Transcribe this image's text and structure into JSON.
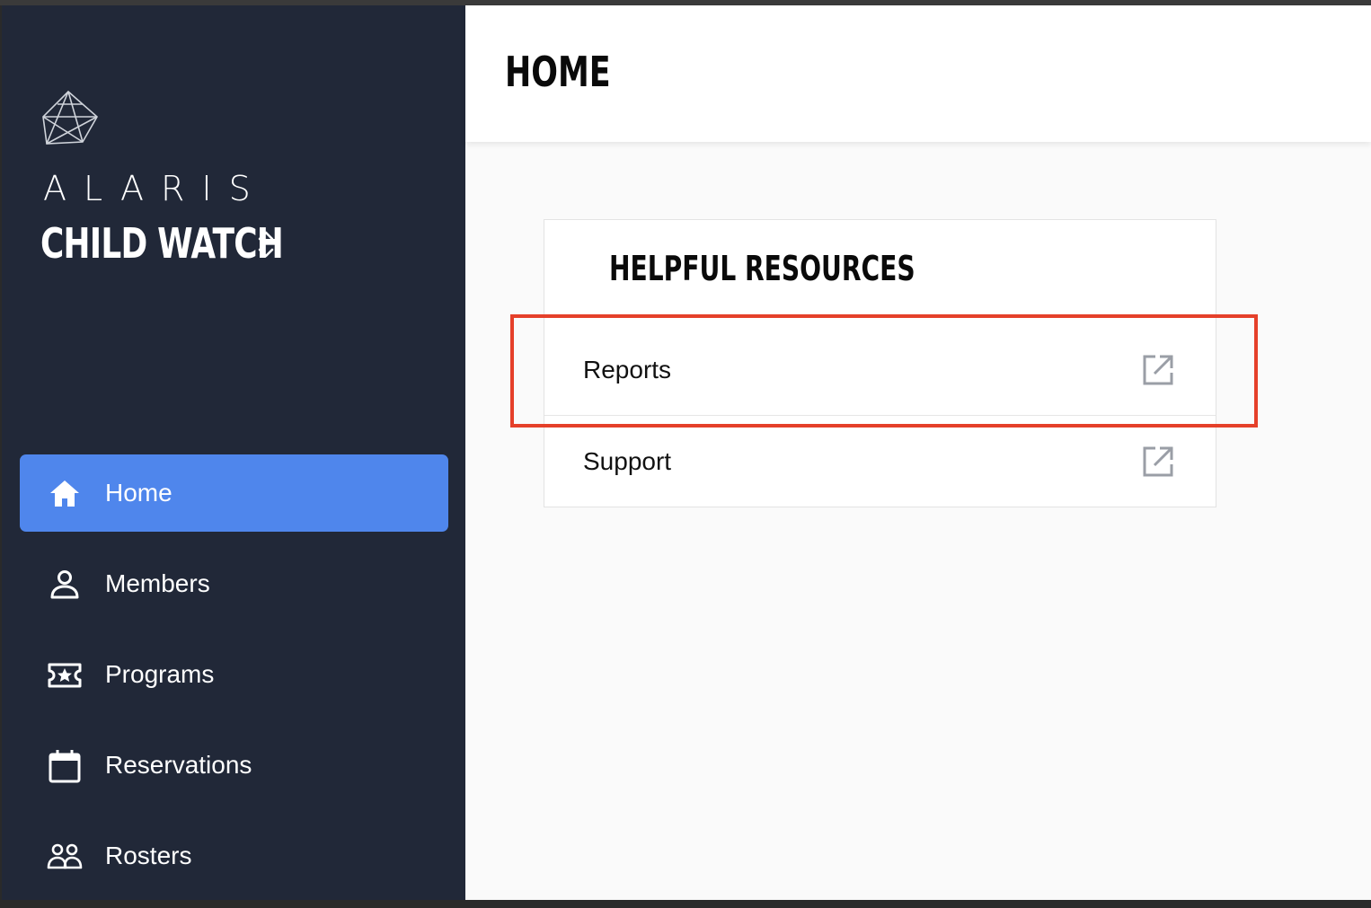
{
  "sidebar": {
    "brand": "ALARIS",
    "app_title": "CHILD WATCH",
    "icons": {
      "logo": "alaris-geometric-logo-icon",
      "switcher": "chevron-up-down-icon"
    },
    "items": [
      {
        "label": "Home",
        "icon": "home-icon",
        "active": true
      },
      {
        "label": "Members",
        "icon": "user-icon",
        "active": false
      },
      {
        "label": "Programs",
        "icon": "ticket-star-icon",
        "active": false
      },
      {
        "label": "Reservations",
        "icon": "calendar-icon",
        "active": false
      },
      {
        "label": "Rosters",
        "icon": "users-icon",
        "active": false
      }
    ]
  },
  "header": {
    "title": "HOME"
  },
  "resources": {
    "title": "HELPFUL RESOURCES",
    "items": [
      {
        "label": "Reports",
        "icon": "external-link-icon",
        "highlighted": true
      },
      {
        "label": "Support",
        "icon": "external-link-icon",
        "highlighted": false
      }
    ]
  },
  "colors": {
    "sidebar_bg": "#212838",
    "active_item_bg": "#4f86ec",
    "highlight": "#e5402a",
    "main_bg": "#fafafa"
  }
}
